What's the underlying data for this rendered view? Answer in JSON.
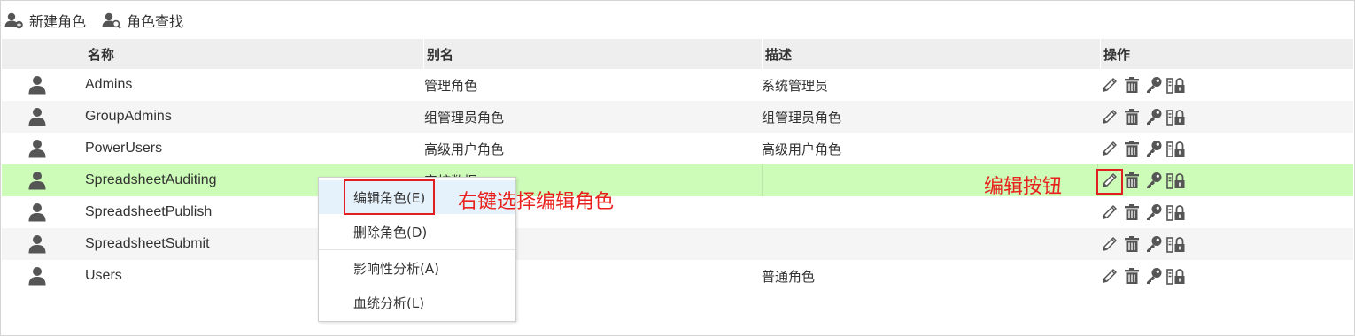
{
  "toolbar": {
    "new_role_label": "新建角色",
    "find_role_label": "角色查找"
  },
  "table": {
    "headers": {
      "name": "名称",
      "alias": "别名",
      "desc": "描述",
      "ops": "操作"
    },
    "rows": [
      {
        "name": "Admins",
        "alias": "管理角色",
        "desc": "系统管理员"
      },
      {
        "name": "GroupAdmins",
        "alias": "组管理员角色",
        "desc": "组管理员角色"
      },
      {
        "name": "PowerUsers",
        "alias": "高级用户角色",
        "desc": "高级用户角色"
      },
      {
        "name": "SpreadsheetAuditing",
        "alias": "审核数据",
        "desc": ""
      },
      {
        "name": "SpreadsheetPublish",
        "alias": "",
        "desc": ""
      },
      {
        "name": "SpreadsheetSubmit",
        "alias": "",
        "desc": ""
      },
      {
        "name": "Users",
        "alias": "",
        "desc": "普通角色"
      }
    ],
    "selected_row": 3
  },
  "context_menu": {
    "items": [
      "编辑角色(E)",
      "删除角色(D)",
      "影响性分析(A)",
      "血统分析(L)"
    ]
  },
  "annotations": {
    "context_hint": "右键选择编辑角色",
    "edit_button_hint": "编辑按钮"
  },
  "colors": {
    "selected_row": "#ccfcb8",
    "alt_row": "#f5f5f5",
    "header": "#eeeeee",
    "annotation_red": "#e8211c",
    "icon_gray": "#555555"
  },
  "icons": {
    "toolbar": [
      "add-user-icon",
      "search-user-icon"
    ],
    "row": "user-icon",
    "ops": [
      "edit-icon",
      "delete-icon",
      "key-icon",
      "permission-lock-icon"
    ]
  }
}
